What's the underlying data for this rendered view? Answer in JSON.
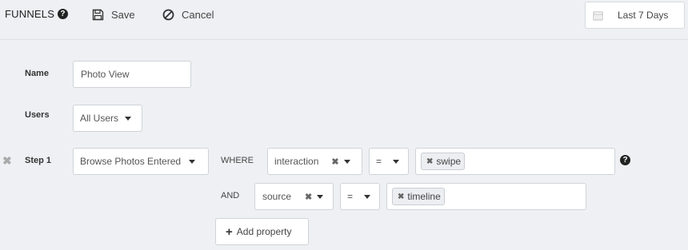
{
  "header": {
    "title": "FUNNELS",
    "save_label": "Save",
    "cancel_label": "Cancel",
    "date_range": "Last 7 Days"
  },
  "form": {
    "name_label": "Name",
    "name_value": "Photo View",
    "users_label": "Users",
    "users_value": "All Users",
    "step_label": "Step 1",
    "event_value": "Browse Photos Entered",
    "where_label": "WHERE",
    "and_label": "AND",
    "filters": [
      {
        "property": "interaction",
        "operator": "=",
        "value": "swipe"
      },
      {
        "property": "source",
        "operator": "=",
        "value": "timeline"
      }
    ],
    "add_property_label": "Add property"
  }
}
